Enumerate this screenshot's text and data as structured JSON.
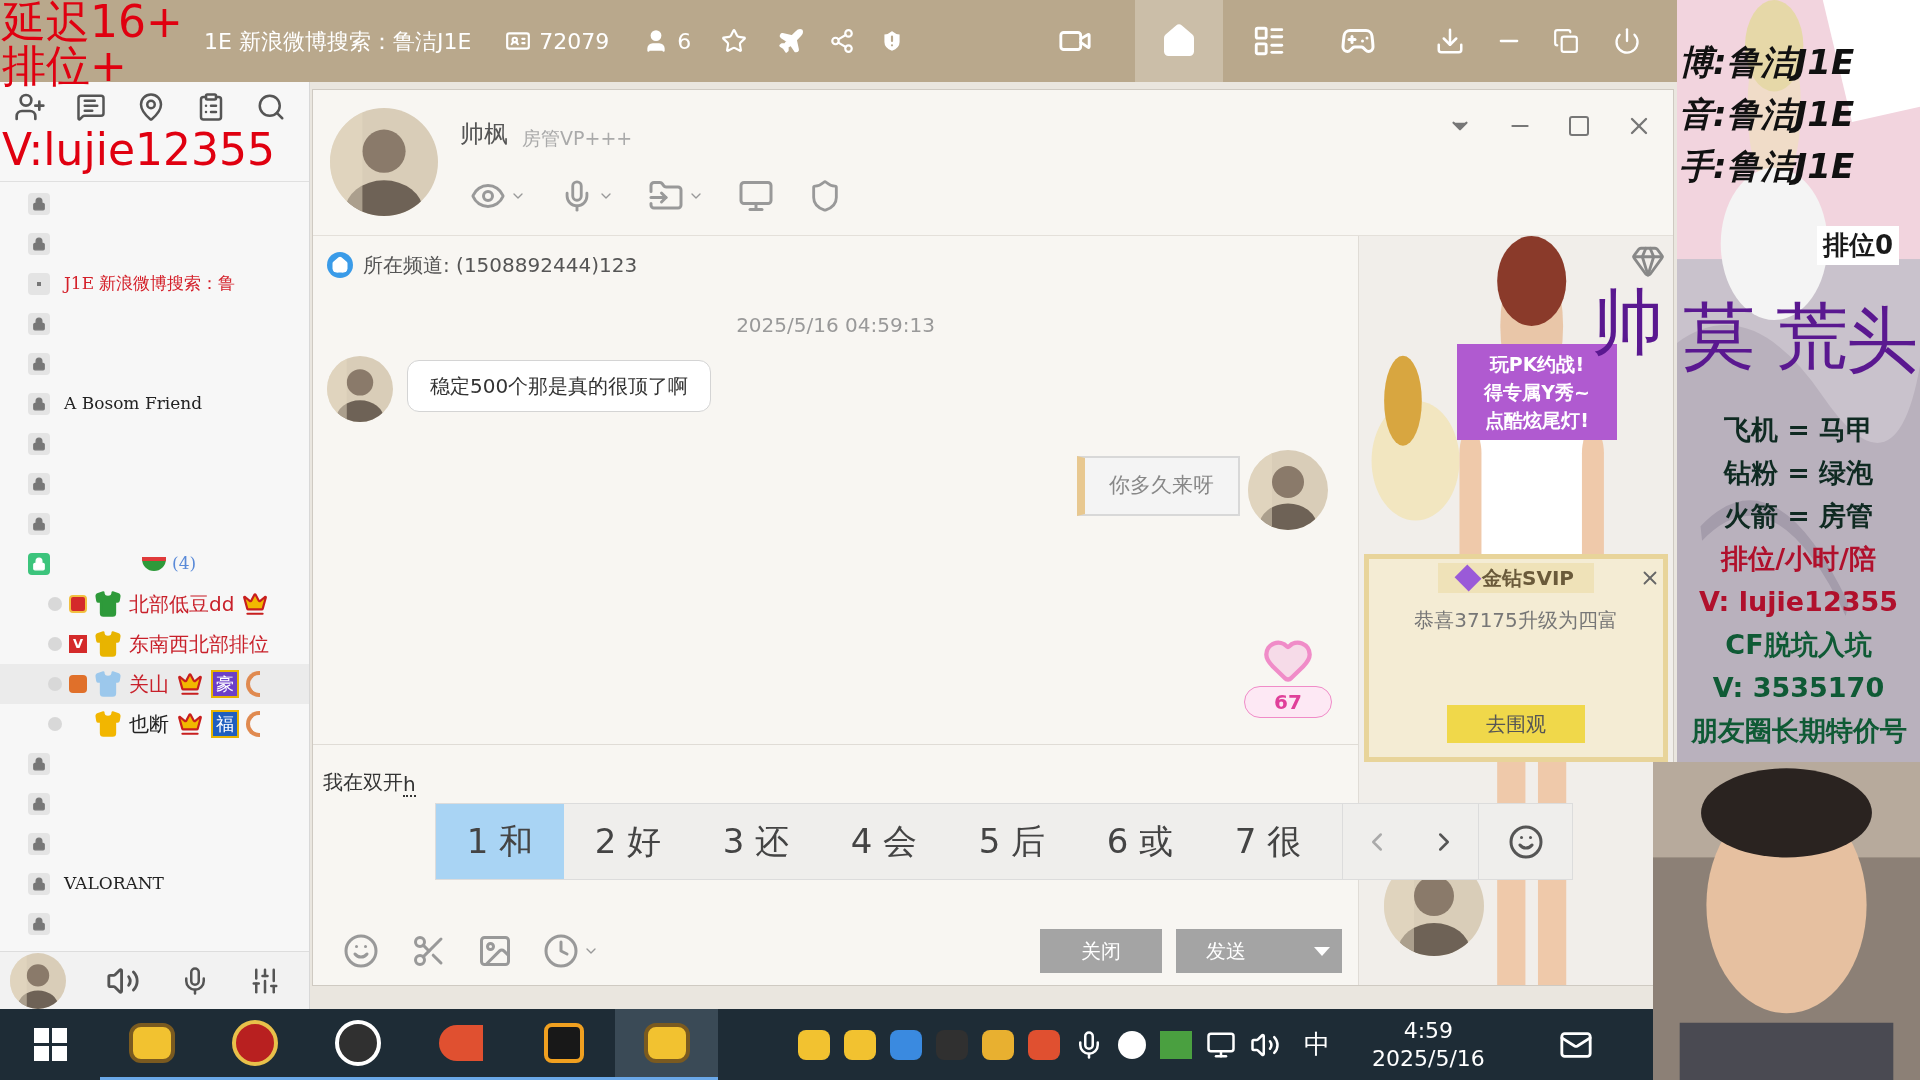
{
  "overlay_text": {
    "lines": [
      "延迟16+",
      "排位+",
      "V:lujie12355"
    ],
    "handwriting": [
      "帅",
      "莫",
      "荒",
      "头"
    ]
  },
  "title_bar": {
    "title": "1E 新浪微博搜索：鲁洁J1E",
    "room_id": "72079",
    "online": "6"
  },
  "sidebar": {
    "items": [
      {
        "kind": "room",
        "active": false
      },
      {
        "kind": "room",
        "active": false
      },
      {
        "kind": "marked_room",
        "active": false,
        "name": "J1E 新浪微博搜索：鲁",
        "color": "#d4202a"
      },
      {
        "kind": "room",
        "active": false
      },
      {
        "kind": "room",
        "active": false
      },
      {
        "kind": "room",
        "active": false,
        "name": "A Bosom Friend",
        "color": "#222222"
      },
      {
        "kind": "room",
        "active": false
      },
      {
        "kind": "room",
        "active": false
      },
      {
        "kind": "room",
        "active": false
      },
      {
        "kind": "group",
        "active": true,
        "count": "(4)",
        "children": [
          {
            "name": "北部低豆dd",
            "color": "#c8202a",
            "selected": false,
            "icons": [
              {
                "kind": "coin"
              },
              {
                "kind": "shirt",
                "color": "#2e9a3a"
              }
            ],
            "tags": [
              {
                "kind": "crown"
              }
            ]
          },
          {
            "name": "东南西北部排位",
            "color": "#c8202a",
            "selected": false,
            "icons": [
              {
                "kind": "letter",
                "text": "V"
              },
              {
                "kind": "shirt",
                "color": "#e8b400"
              }
            ]
          },
          {
            "name": "关山",
            "color": "#c8202a",
            "selected": true,
            "icons": [
              {
                "kind": "level"
              },
              {
                "kind": "shirt",
                "color": "#9cc8ec"
              }
            ],
            "tags": [
              {
                "kind": "crown"
              },
              {
                "kind": "label",
                "text": "豪",
                "color": "#6b3fc8"
              },
              {
                "kind": "ring"
              }
            ]
          },
          {
            "name": "也断",
            "color": "#222222",
            "selected": false,
            "icons": [
              {
                "kind": "shirt",
                "color": "#f2b600"
              }
            ],
            "tags": [
              {
                "kind": "crown"
              },
              {
                "kind": "label",
                "text": "福",
                "color": "#1f5fbf"
              },
              {
                "kind": "ring"
              }
            ]
          }
        ]
      },
      {
        "kind": "room",
        "active": false
      },
      {
        "kind": "room",
        "active": false
      },
      {
        "kind": "room",
        "active": false
      },
      {
        "kind": "room",
        "active": false,
        "name": "VALORANT",
        "color": "#222222"
      },
      {
        "kind": "room",
        "active": false
      }
    ]
  },
  "chat": {
    "name": "帅枫",
    "role": "房管VP+++",
    "channel": "所在频道: (1508892444)123",
    "timestamp": "2025/5/16 04:59:13",
    "messages": [
      {
        "kind": "incoming",
        "text": "稳定500个那是真的很顶了啊"
      },
      {
        "kind": "outgoing",
        "text": "你多久来呀"
      }
    ],
    "likes": "67",
    "input": "我在双开",
    "composition": "h",
    "candidates": [
      {
        "label": "1 和",
        "selected": true
      },
      {
        "label": "2 好",
        "selected": false
      },
      {
        "label": "3 还",
        "selected": false
      },
      {
        "label": "4 会",
        "selected": false
      },
      {
        "label": "5 后",
        "selected": false
      },
      {
        "label": "6 或",
        "selected": false
      },
      {
        "label": "7 很",
        "selected": false
      }
    ],
    "buttons": [
      "关闭",
      "发送"
    ]
  },
  "promo": {
    "bubble": [
      "玩PK约战!",
      "得专属Y秀~",
      "点酷炫尾灯!"
    ],
    "svip_title": "金钻SVIP",
    "svip_text": "恭喜37175升级为四富",
    "svip_button": "去围观"
  },
  "poster": {
    "header": [
      "博:鲁洁J1E",
      "音:鲁洁J1E",
      "手:鲁洁J1E"
    ],
    "tag": "排位0",
    "lines": [
      {
        "text": "飞机 = 马甲",
        "color": "#0f2a22"
      },
      {
        "text": "钻粉 = 绿泡",
        "color": "#0f2a22"
      },
      {
        "text": "火箭 = 房管",
        "color": "#0f2a22"
      },
      {
        "text": "排位/小时/陪",
        "color": "#b0102c"
      },
      {
        "text": "V: lujie12355",
        "color": "#b0102c"
      },
      {
        "text": "CF脱坑入坑",
        "color": "#0f5a35"
      },
      {
        "text": "V: 3535170",
        "color": "#0f5a35"
      },
      {
        "text": "朋友圈长期特价号",
        "color": "#0f5a35"
      }
    ]
  },
  "taskbar": {
    "apps": [
      {
        "kind": "yy",
        "active": false
      },
      {
        "kind": "cf",
        "active": false
      },
      {
        "kind": "obs",
        "active": false
      },
      {
        "kind": "bird",
        "active": false
      },
      {
        "kind": "g",
        "active": false
      },
      {
        "kind": "yy",
        "active": true
      }
    ],
    "ime": "中",
    "time": "4:59",
    "date": "2025/5/16"
  }
}
